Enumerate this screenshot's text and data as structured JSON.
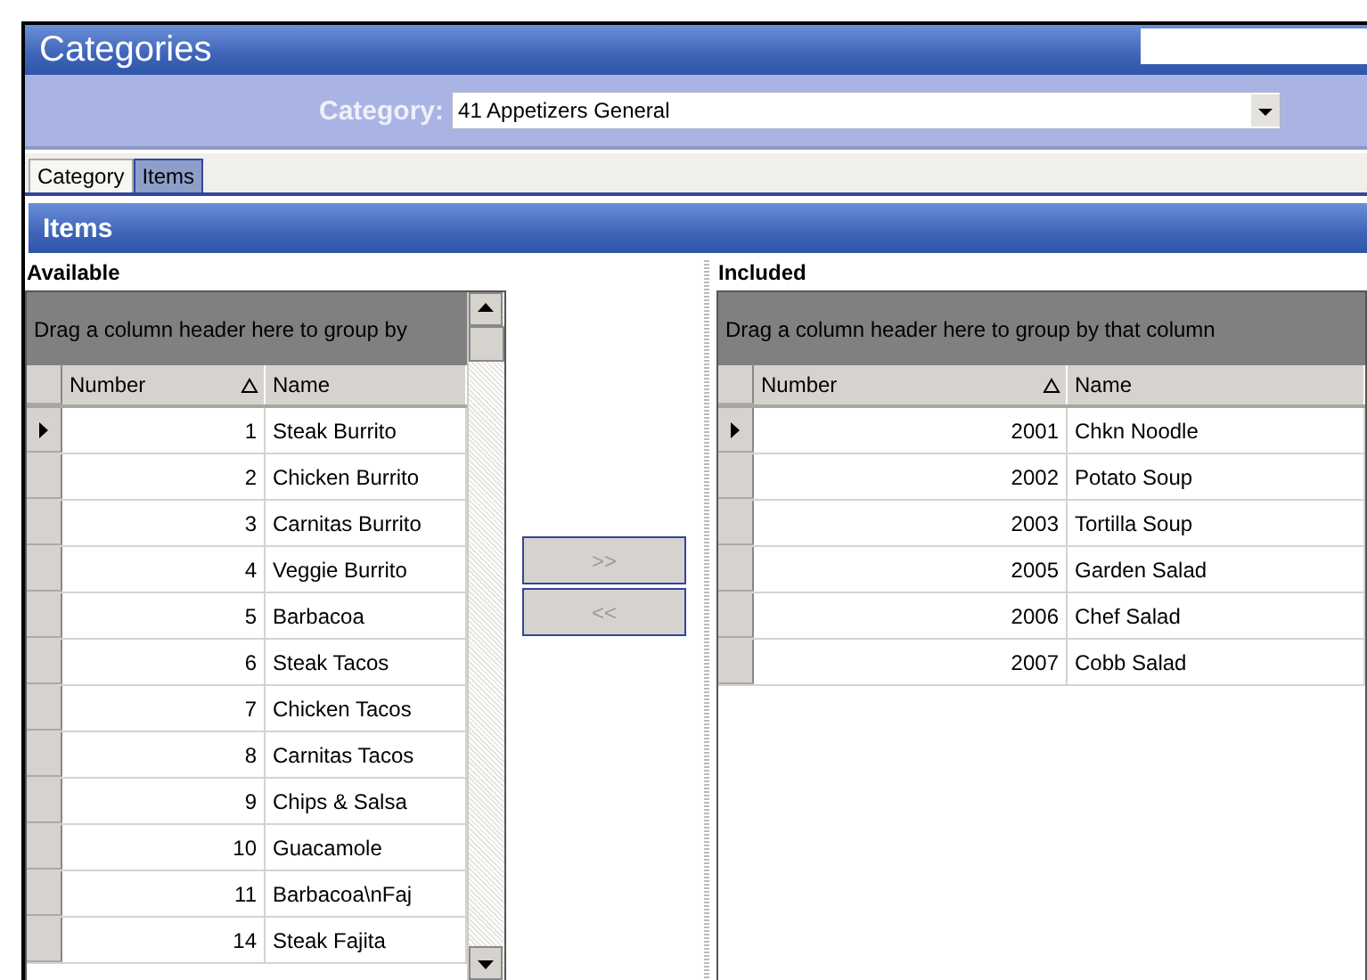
{
  "window": {
    "title": "Categories"
  },
  "category": {
    "label": "Category:",
    "value": "41 Appetizers General"
  },
  "tabs": [
    {
      "label": "Category",
      "selected": false
    },
    {
      "label": "Items",
      "selected": true
    }
  ],
  "section": {
    "title": "Items"
  },
  "available": {
    "label": "Available",
    "group_hint": "Drag a column header here to group by",
    "columns": [
      "Number",
      "Name"
    ],
    "rows": [
      {
        "number": "1",
        "name": "Steak Burrito",
        "current": true
      },
      {
        "number": "2",
        "name": "Chicken Burrito",
        "current": false
      },
      {
        "number": "3",
        "name": "Carnitas Burrito",
        "current": false
      },
      {
        "number": "4",
        "name": "Veggie Burrito",
        "current": false
      },
      {
        "number": "5",
        "name": "Barbacoa",
        "current": false
      },
      {
        "number": "6",
        "name": "Steak Tacos",
        "current": false
      },
      {
        "number": "7",
        "name": "Chicken Tacos",
        "current": false
      },
      {
        "number": "8",
        "name": "Carnitas Tacos",
        "current": false
      },
      {
        "number": "9",
        "name": "Chips & Salsa",
        "current": false
      },
      {
        "number": "10",
        "name": "Guacamole",
        "current": false
      },
      {
        "number": "11",
        "name": "Barbacoa\\nFaj",
        "current": false
      },
      {
        "number": "14",
        "name": "Steak Fajita",
        "current": false
      }
    ]
  },
  "buttons": [
    {
      "label": ">>",
      "disabled": true
    },
    {
      "label": "<<",
      "disabled": true
    }
  ],
  "included": {
    "label": "Included",
    "group_hint": "Drag a column header here to group by that column",
    "columns": [
      "Number",
      "Name"
    ],
    "rows": [
      {
        "number": "2001",
        "name": "Chkn Noodle",
        "current": true
      },
      {
        "number": "2002",
        "name": "Potato Soup",
        "current": false
      },
      {
        "number": "2003",
        "name": "Tortilla Soup",
        "current": false
      },
      {
        "number": "2005",
        "name": "Garden Salad",
        "current": false
      },
      {
        "number": "2006",
        "name": "Chef Salad",
        "current": false
      },
      {
        "number": "2007",
        "name": "Cobb Salad",
        "current": false
      }
    ]
  }
}
